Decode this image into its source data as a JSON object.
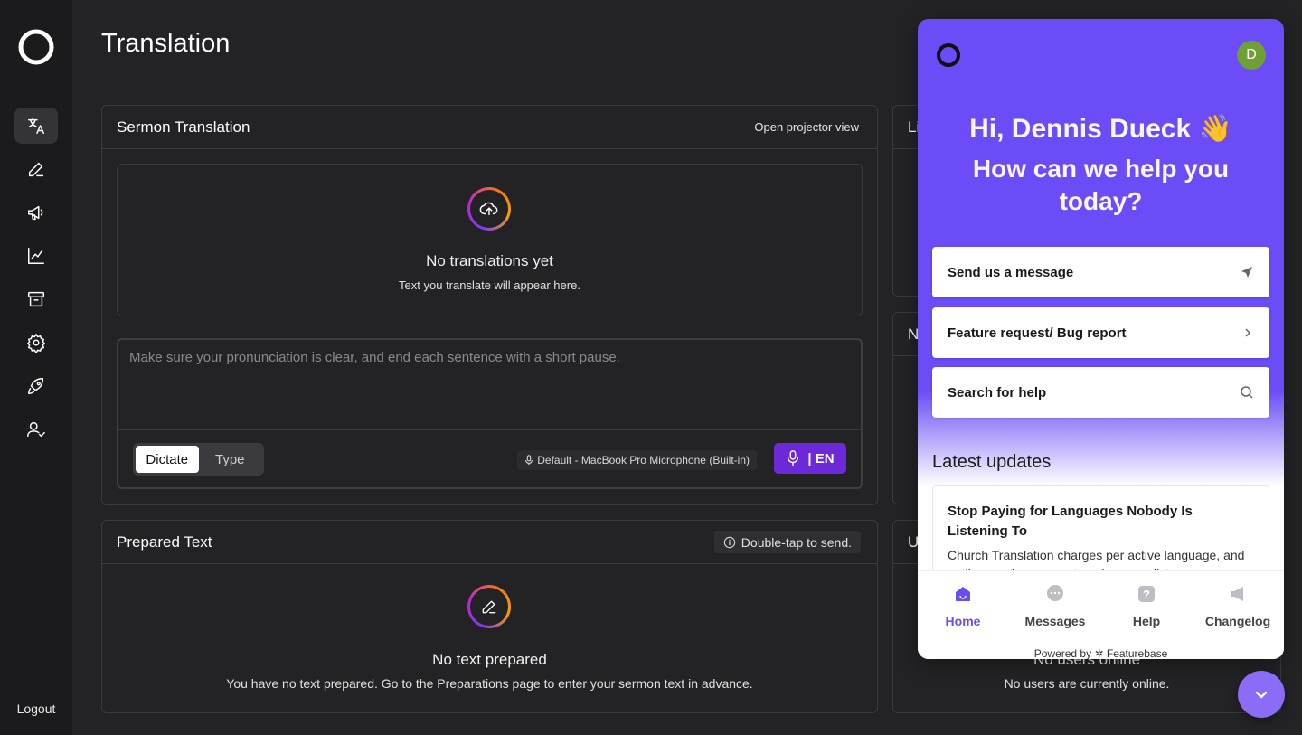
{
  "sidebar": {
    "items": [
      {
        "icon": "translate-icon",
        "active": true
      },
      {
        "icon": "pencil-icon"
      },
      {
        "icon": "megaphone-icon"
      },
      {
        "icon": "chart-icon"
      },
      {
        "icon": "archive-icon"
      },
      {
        "icon": "gear-icon"
      },
      {
        "icon": "rocket-icon"
      },
      {
        "icon": "user-check-icon"
      }
    ],
    "logout_label": "Logout"
  },
  "page": {
    "title": "Translation"
  },
  "sermon": {
    "title": "Sermon Translation",
    "projector_label": "Open projector view",
    "empty_title": "No translations yet",
    "empty_sub": "Text you translate will appear here.",
    "input_placeholder": "Make sure your pronunciation is clear, and end each sentence with a short pause.",
    "mode_dictate": "Dictate",
    "mode_type": "Type",
    "mic_device": "Default - MacBook Pro Microphone (Built-in)",
    "lang_label": "| EN"
  },
  "prepared": {
    "title": "Prepared Text",
    "hint": "Double-tap to send.",
    "empty_title": "No text prepared",
    "empty_sub": "You have no text prepared. Go to the Preparations page to enter your sermon text in advance."
  },
  "right_cards": {
    "languages_title_fragment": "Li",
    "notes_title_fragment": "N",
    "users_title_fragment": "U",
    "users_empty_title": "No users online",
    "users_empty_sub": "No users are currently online."
  },
  "widget": {
    "avatar_initial": "D",
    "greeting": "Hi, Dennis Dueck 👋",
    "help": "How can we help you today?",
    "actions": [
      {
        "label": "Send us a message",
        "icon": "send-icon"
      },
      {
        "label": "Feature request/ Bug report",
        "icon": "chevron-right-icon"
      },
      {
        "label": "Search for help",
        "icon": "search-icon"
      }
    ],
    "updates_title": "Latest updates",
    "update": {
      "title": "Stop Paying for Languages Nobody Is Listening To",
      "body": "Church Translation charges per active language, and until now a language stayed on your list"
    },
    "tabs": [
      {
        "label": "Home",
        "active": true
      },
      {
        "label": "Messages"
      },
      {
        "label": "Help"
      },
      {
        "label": "Changelog"
      }
    ],
    "powered_by": "Powered by",
    "powered_brand": "Featurebase",
    "accent": "#6b4cf6"
  }
}
